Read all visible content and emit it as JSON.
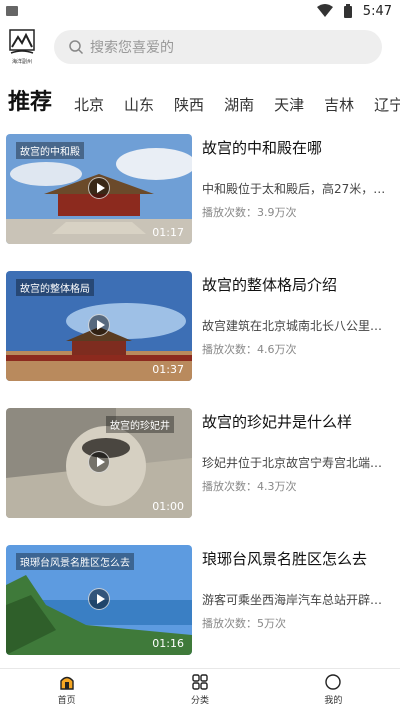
{
  "status_bar": {
    "time": "5:47"
  },
  "header": {
    "logo_text": "海洋副州",
    "search_placeholder": "搜索您喜爱的"
  },
  "tabs": [
    "推荐",
    "北京",
    "山东",
    "陕西",
    "湖南",
    "天津",
    "吉林",
    "辽宁"
  ],
  "videos": [
    {
      "thumb_title": "故宫的中和殿",
      "duration": "01:17",
      "title": "故宫的中和殿在哪",
      "desc": "中和殿位于太和殿后，高27米，平…",
      "plays": "播放次数：3.9万次"
    },
    {
      "thumb_title": "故宫的整体格局",
      "duration": "01:37",
      "title": "故宫的整体格局介绍",
      "desc": "故宫建筑在北京城南北长八公里的…",
      "plays": "播放次数：4.6万次"
    },
    {
      "thumb_title": "故宫的珍妃井",
      "duration": "01:00",
      "title": "故宫的珍妃井是什么样",
      "desc": "珍妃井位于北京故宫宁寿宫北端的…",
      "plays": "播放次数：4.3万次"
    },
    {
      "thumb_title": "琅琊台风景名胜区怎么去",
      "duration": "01:16",
      "title": "琅琊台风景名胜区怎么去",
      "desc": "游客可乘坐西海岸汽车总站开辟501…",
      "plays": "播放次数：5万次"
    }
  ],
  "bottom_nav": [
    {
      "label": "首页",
      "icon": "home-icon",
      "active": true
    },
    {
      "label": "分类",
      "icon": "category-icon",
      "active": false
    },
    {
      "label": "我的",
      "icon": "profile-icon",
      "active": false
    }
  ],
  "colors": {
    "accent": "#f5a623",
    "search_bg": "#eeeeee"
  }
}
